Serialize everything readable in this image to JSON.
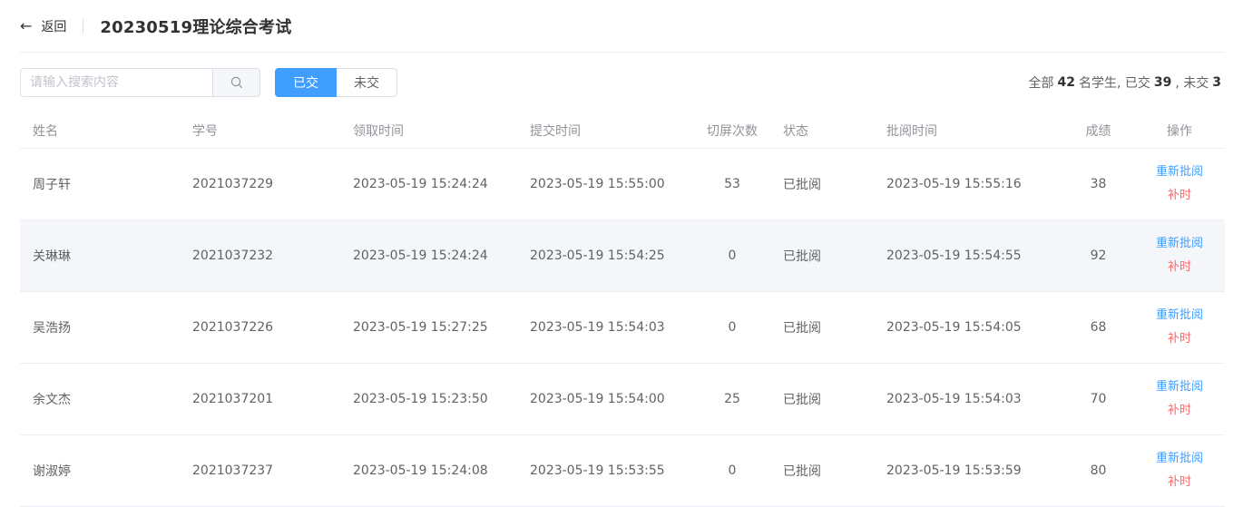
{
  "header": {
    "back_label": "返回",
    "title": "20230519理论综合考试"
  },
  "toolbar": {
    "search_placeholder": "请输入搜索内容",
    "filters": [
      {
        "label": "已交",
        "active": true
      },
      {
        "label": "未交",
        "active": false
      }
    ],
    "summary": {
      "prefix": "全部",
      "total": "42",
      "mid": "名学生, 已交",
      "submitted": "39",
      "sep": ", 未交",
      "unsubmitted": "3"
    }
  },
  "table": {
    "columns": [
      "姓名",
      "学号",
      "领取时间",
      "提交时间",
      "切屏次数",
      "状态",
      "批阅时间",
      "成绩",
      "操作"
    ],
    "actions": {
      "regrade": "重新批阅",
      "extend": "补时"
    },
    "rows": [
      {
        "name": "周子轩",
        "id": "2021037229",
        "received": "2023-05-19 15:24:24",
        "submitted": "2023-05-19 15:55:00",
        "switches": "53",
        "status": "已批阅",
        "graded": "2023-05-19 15:55:16",
        "score": "38"
      },
      {
        "name": "关琳琳",
        "id": "2021037232",
        "received": "2023-05-19 15:24:24",
        "submitted": "2023-05-19 15:54:25",
        "switches": "0",
        "status": "已批阅",
        "graded": "2023-05-19 15:54:55",
        "score": "92"
      },
      {
        "name": "吴浩扬",
        "id": "2021037226",
        "received": "2023-05-19 15:27:25",
        "submitted": "2023-05-19 15:54:03",
        "switches": "0",
        "status": "已批阅",
        "graded": "2023-05-19 15:54:05",
        "score": "68"
      },
      {
        "name": "余文杰",
        "id": "2021037201",
        "received": "2023-05-19 15:23:50",
        "submitted": "2023-05-19 15:54:00",
        "switches": "25",
        "status": "已批阅",
        "graded": "2023-05-19 15:54:03",
        "score": "70"
      },
      {
        "name": "谢淑婷",
        "id": "2021037237",
        "received": "2023-05-19 15:24:08",
        "submitted": "2023-05-19 15:53:55",
        "switches": "0",
        "status": "已批阅",
        "graded": "2023-05-19 15:53:59",
        "score": "80"
      }
    ]
  },
  "colors": {
    "primary": "#409eff",
    "danger": "#f56c6c",
    "row_alt_bg": "#f4f6fa"
  },
  "icons": {
    "back": "arrow-left-icon",
    "search": "search-icon"
  }
}
